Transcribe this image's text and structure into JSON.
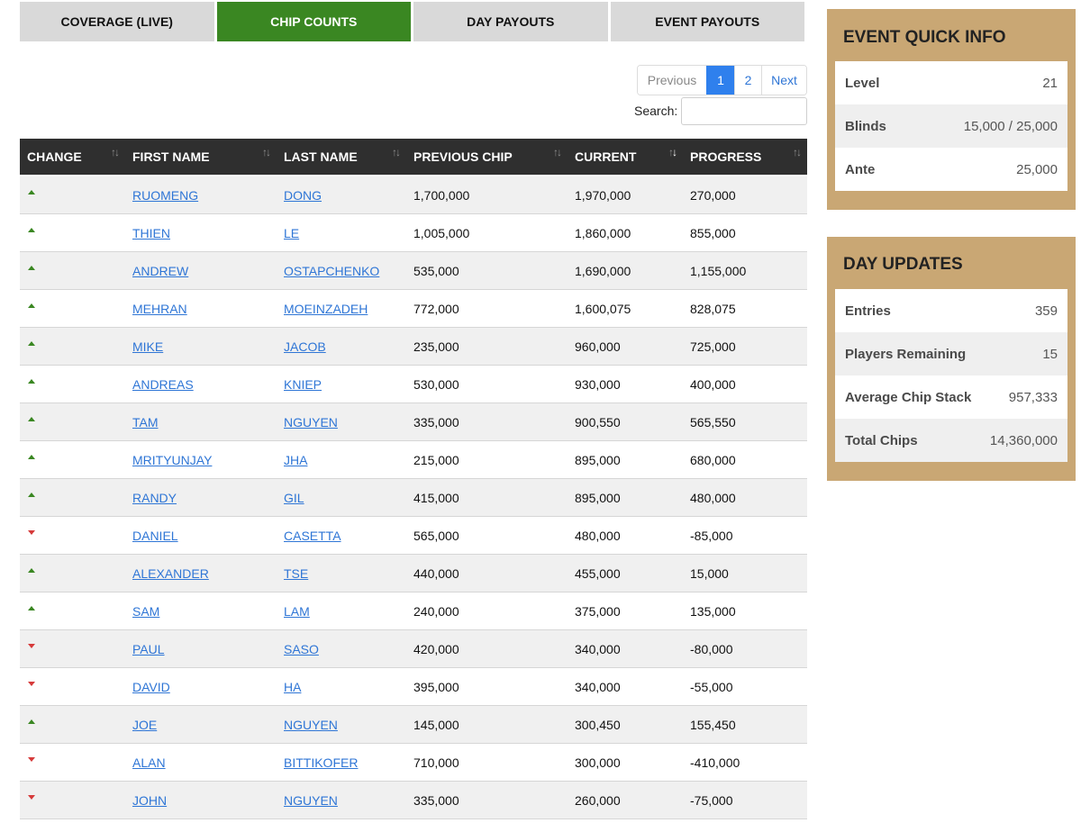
{
  "tabs": [
    {
      "label": "COVERAGE (LIVE)",
      "active": false
    },
    {
      "label": "CHIP COUNTS",
      "active": true
    },
    {
      "label": "DAY PAYOUTS",
      "active": false
    },
    {
      "label": "EVENT PAYOUTS",
      "active": false
    }
  ],
  "pagination": {
    "previous": "Previous",
    "page1": "1",
    "page2": "2",
    "next": "Next"
  },
  "search": {
    "label": "Search:",
    "value": ""
  },
  "table": {
    "headers": [
      "CHANGE",
      "FIRST NAME",
      "LAST NAME",
      "PREVIOUS CHIP",
      "CURRENT",
      "PROGRESS"
    ],
    "rows": [
      {
        "change": "up",
        "first": "RUOMENG",
        "last": "DONG",
        "previous": "1,700,000",
        "current": "1,970,000",
        "progress": "270,000"
      },
      {
        "change": "up",
        "first": "THIEN",
        "last": "LE",
        "previous": "1,005,000",
        "current": "1,860,000",
        "progress": "855,000"
      },
      {
        "change": "up",
        "first": "ANDREW",
        "last": "OSTAPCHENKO",
        "previous": "535,000",
        "current": "1,690,000",
        "progress": "1,155,000"
      },
      {
        "change": "up",
        "first": "MEHRAN",
        "last": "MOEINZADEH",
        "previous": "772,000",
        "current": "1,600,075",
        "progress": "828,075"
      },
      {
        "change": "up",
        "first": "MIKE",
        "last": "JACOB",
        "previous": "235,000",
        "current": "960,000",
        "progress": "725,000"
      },
      {
        "change": "up",
        "first": "ANDREAS",
        "last": "KNIEP",
        "previous": "530,000",
        "current": "930,000",
        "progress": "400,000"
      },
      {
        "change": "up",
        "first": "TAM",
        "last": "NGUYEN",
        "previous": "335,000",
        "current": "900,550",
        "progress": "565,550"
      },
      {
        "change": "up",
        "first": "MRITYUNJAY",
        "last": "JHA",
        "previous": "215,000",
        "current": "895,000",
        "progress": "680,000"
      },
      {
        "change": "up",
        "first": "RANDY",
        "last": "GIL",
        "previous": "415,000",
        "current": "895,000",
        "progress": "480,000"
      },
      {
        "change": "down",
        "first": "DANIEL",
        "last": "CASETTA",
        "previous": "565,000",
        "current": "480,000",
        "progress": "-85,000"
      },
      {
        "change": "up",
        "first": "ALEXANDER",
        "last": "TSE",
        "previous": "440,000",
        "current": "455,000",
        "progress": "15,000"
      },
      {
        "change": "up",
        "first": "SAM",
        "last": "LAM",
        "previous": "240,000",
        "current": "375,000",
        "progress": "135,000"
      },
      {
        "change": "down",
        "first": "PAUL",
        "last": "SASO",
        "previous": "420,000",
        "current": "340,000",
        "progress": "-80,000"
      },
      {
        "change": "down",
        "first": "DAVID",
        "last": "HA",
        "previous": "395,000",
        "current": "340,000",
        "progress": "-55,000"
      },
      {
        "change": "up",
        "first": "JOE",
        "last": "NGUYEN",
        "previous": "145,000",
        "current": "300,450",
        "progress": "155,450"
      },
      {
        "change": "down",
        "first": "ALAN",
        "last": "BITTIKOFER",
        "previous": "710,000",
        "current": "300,000",
        "progress": "-410,000"
      },
      {
        "change": "down",
        "first": "JOHN",
        "last": "NGUYEN",
        "previous": "335,000",
        "current": "260,000",
        "progress": "-75,000"
      }
    ]
  },
  "event_info": {
    "title": "EVENT QUICK INFO",
    "rows": [
      {
        "label": "Level",
        "value": "21"
      },
      {
        "label": "Blinds",
        "value": "15,000 / 25,000"
      },
      {
        "label": "Ante",
        "value": "25,000"
      }
    ]
  },
  "day_updates": {
    "title": "DAY UPDATES",
    "rows": [
      {
        "label": "Entries",
        "value": "359"
      },
      {
        "label": "Players Remaining",
        "value": "15"
      },
      {
        "label": "Average Chip Stack",
        "value": "957,333"
      },
      {
        "label": "Total Chips",
        "value": "14,360,000"
      }
    ]
  },
  "colors": {
    "active_tab": "#3a8722",
    "panel_bg": "#c9a774",
    "link": "#2f76d6",
    "up": "#3a8722",
    "down": "#d63a3a"
  }
}
